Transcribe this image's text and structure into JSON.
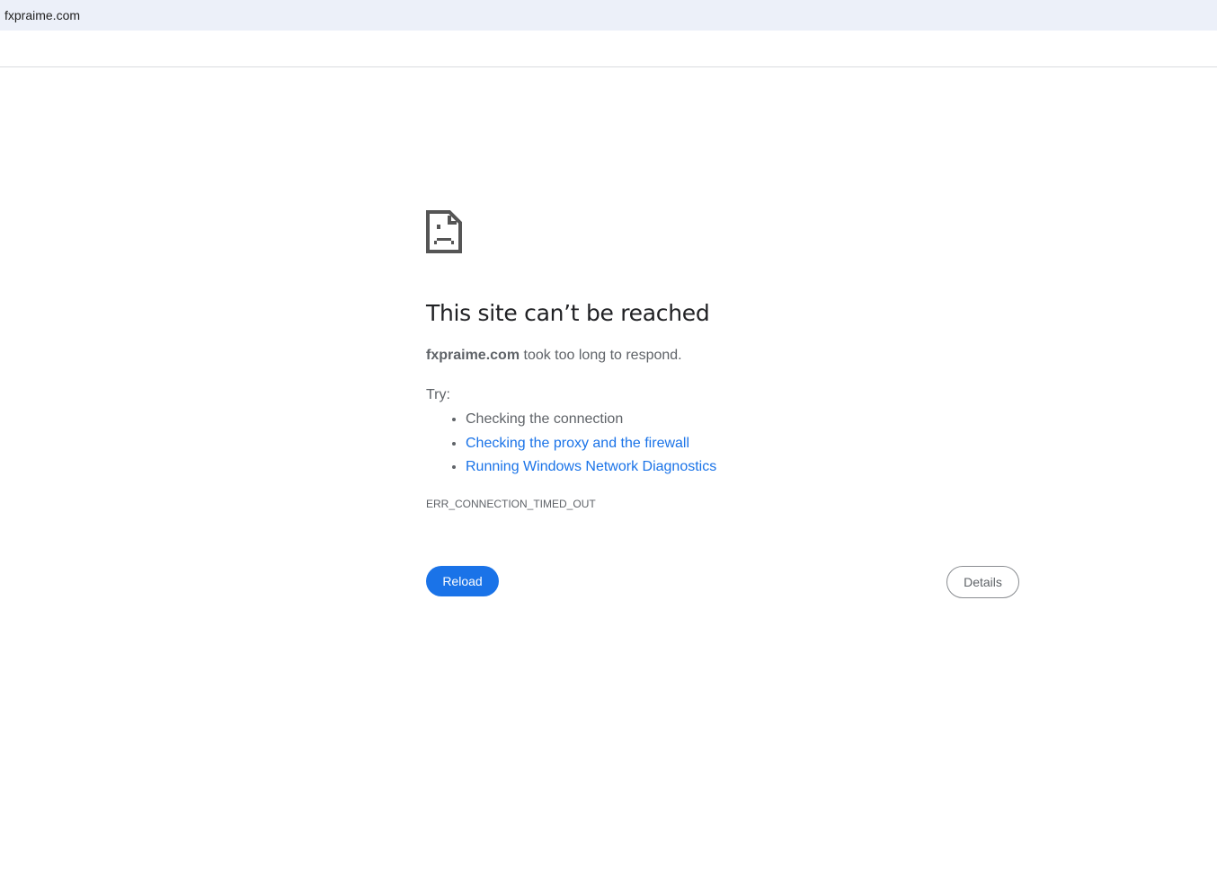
{
  "tab": {
    "title": "fxpraime.com"
  },
  "error": {
    "title": "This site can’t be reached",
    "host": "fxpraime.com",
    "message": " took too long to respond.",
    "try_label": "Try:",
    "suggestions": [
      "Checking the connection",
      "Checking the proxy and the firewall",
      "Running Windows Network Diagnostics"
    ],
    "code": "ERR_CONNECTION_TIMED_OUT",
    "reload_label": "Reload",
    "details_label": "Details",
    "icon": "sad-page-icon"
  },
  "colors": {
    "accent": "#1a73e8",
    "titlebar": "#ecf0f9"
  }
}
